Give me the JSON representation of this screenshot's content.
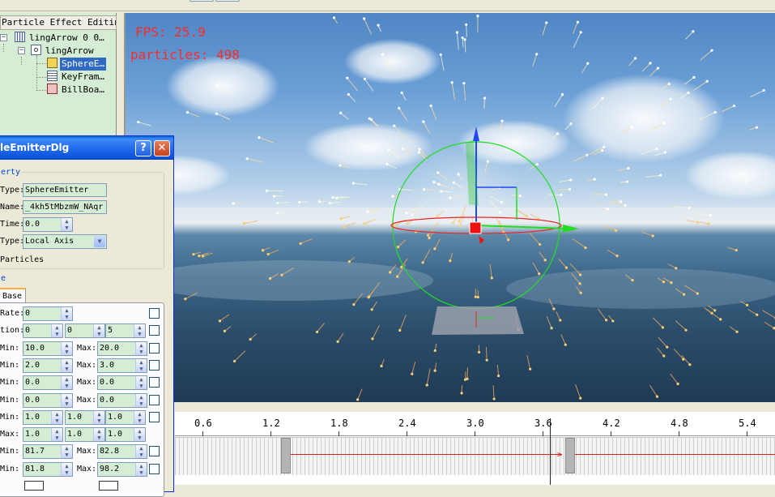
{
  "tree": {
    "header": "Particle Effect Editing",
    "nodes": [
      {
        "label": "lingArrow 0 0…",
        "icon": "grid-icon"
      },
      {
        "label": "lingArrow",
        "icon": "gear-node-icon"
      },
      {
        "label": "SphereE…",
        "icon": "emitter-icon",
        "selected": true
      },
      {
        "label": "KeyFram…",
        "icon": "list-icon"
      },
      {
        "label": "BillBoa…",
        "icon": "billboard-icon"
      }
    ]
  },
  "viewport": {
    "fps": "FPS: 25.9",
    "particles": "particles: 498"
  },
  "dialog": {
    "title": "leEmitterDlg",
    "help": "?",
    "close": "✕",
    "property_group": "erty",
    "type_label": "Type:",
    "type_value": "SphereEmitter",
    "name_label": "Name:",
    "name_value": "_4kh5tMbzmW_NAqr",
    "time_label": "Time:",
    "time_value": "0.0",
    "space_label": "Type:",
    "space_value": "Local Axis",
    "particles_label": "Particles",
    "section2": "e",
    "tab_base": "Base",
    "rows": [
      {
        "label": "Rate:",
        "a": "0"
      },
      {
        "label": "tion:",
        "a": "0",
        "b": "0",
        "c": "5"
      },
      {
        "label": "Min:",
        "a": "10.0",
        "max_label": "Max:",
        "b": "20.0"
      },
      {
        "label": "Min:",
        "a": "2.0",
        "max_label": "Max:",
        "b": "3.0"
      },
      {
        "label": "Min:",
        "a": "0.0",
        "max_label": "Max:",
        "b": "0.0"
      },
      {
        "label": "Min:",
        "a": "0.0",
        "max_label": "Max:",
        "b": "0.0"
      },
      {
        "label": "Min:",
        "a": "1.0",
        "b": "1.0",
        "c": "1.0"
      },
      {
        "label": "Max:",
        "a": "1.0",
        "b": "1.0",
        "c": "1.0"
      },
      {
        "label": "Min:",
        "a": "81.7",
        "max_label": "Max:",
        "b": "82.8"
      },
      {
        "label": "Min:",
        "a": "81.8",
        "max_label": "Max:",
        "b": "98.2"
      }
    ]
  },
  "timeline": {
    "ticks": [
      "0.6",
      "1.2",
      "1.8",
      "2.4",
      "3.0",
      "3.6",
      "4.2",
      "4.8",
      "5.4"
    ]
  }
}
